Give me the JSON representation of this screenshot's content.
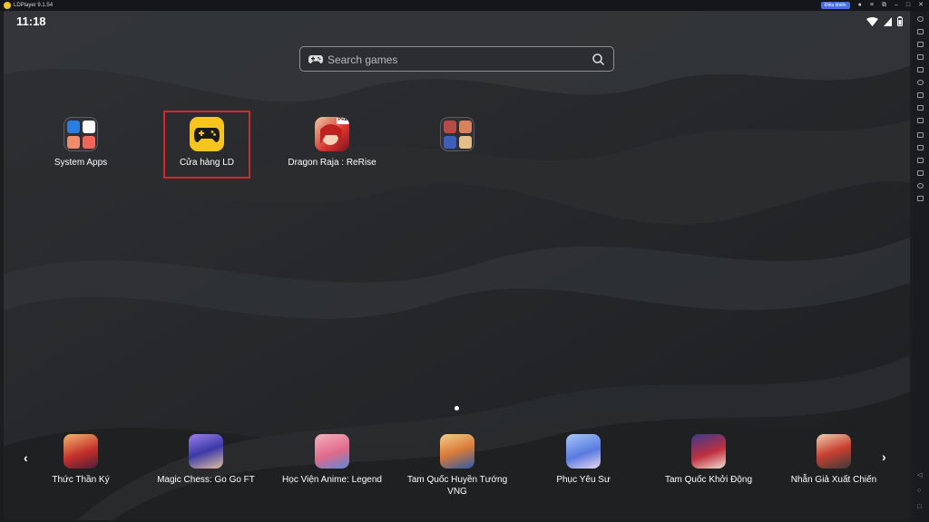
{
  "window": {
    "title": "LDPlayer 9.1.54",
    "badge": "Điều khiển"
  },
  "status_bar": {
    "time": "11:18"
  },
  "search": {
    "placeholder": "Search games"
  },
  "apps": [
    {
      "label": "System Apps"
    },
    {
      "label": "Cửa hàng LD"
    },
    {
      "label": "Dragon Raja : ReRise",
      "badge": "PRE"
    },
    {
      "label": ""
    }
  ],
  "dock": [
    {
      "label": "Thức Thần Ký"
    },
    {
      "label": "Magic Chess: Go Go FT"
    },
    {
      "label": "Học Viện Anime: Legend"
    },
    {
      "label": "Tam Quốc Huyền Tướng VNG"
    },
    {
      "label": "Phục Yêu Sư"
    },
    {
      "label": "Tam Quốc Khởi Động"
    },
    {
      "label": "Nhẫn Giả Xuất Chiến"
    }
  ],
  "colors": {
    "accent_store": "#f7c51c",
    "selection": "#d8242a"
  },
  "icons": {
    "search": "gamepad-icon",
    "search_action": "magnifier-icon",
    "nav_prev": "chevron-left-icon",
    "nav_next": "chevron-right-icon"
  }
}
